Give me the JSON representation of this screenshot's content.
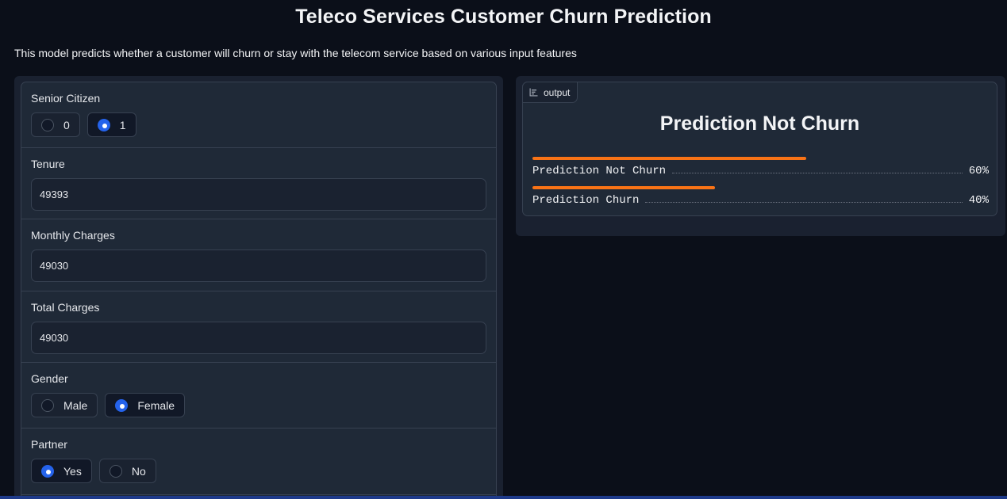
{
  "header": {
    "title": "Teleco Services Customer Churn Prediction",
    "description": "This model predicts whether a customer will churn or stay with the telecom service based on various input features"
  },
  "inputs": {
    "senior_citizen": {
      "label": "Senior Citizen",
      "options": [
        "0",
        "1"
      ],
      "selected": "1"
    },
    "tenure": {
      "label": "Tenure",
      "value": "49393"
    },
    "monthly_charges": {
      "label": "Monthly Charges",
      "value": "49030"
    },
    "total_charges": {
      "label": "Total Charges",
      "value": "49030"
    },
    "gender": {
      "label": "Gender",
      "options": [
        "Male",
        "Female"
      ],
      "selected": "Female"
    },
    "partner": {
      "label": "Partner",
      "options": [
        "Yes",
        "No"
      ],
      "selected": "Yes"
    }
  },
  "output": {
    "tag_label": "output",
    "tag_icon": "chart-bar-icon",
    "prediction": "Prediction Not Churn",
    "confidences": [
      {
        "label": "Prediction Not Churn",
        "percent_text": "60%",
        "value": 0.6
      },
      {
        "label": "Prediction Churn",
        "percent_text": "40%",
        "value": 0.4
      }
    ]
  },
  "colors": {
    "background": "#0b0f19",
    "panel": "#1f2937",
    "accent": "#2563eb",
    "bar": "#f97316"
  }
}
